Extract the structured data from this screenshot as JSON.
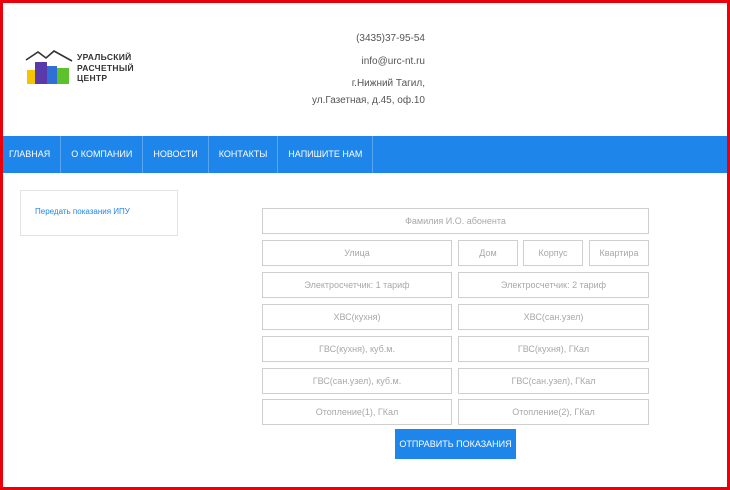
{
  "logo": {
    "lines": [
      "УРАЛЬСКИЙ",
      "РАСЧЕТНЫЙ",
      "ЦЕНТР"
    ]
  },
  "contacts": {
    "phone": "(3435)37-95-54",
    "email": "info@urc-nt.ru",
    "city": "г.Нижний Тагил,",
    "address": "ул.Газетная, д.45, оф.10"
  },
  "nav": {
    "items": [
      "ГЛАВНАЯ",
      "О КОМПАНИИ",
      "НОВОСТИ",
      "КОНТАКТЫ",
      "НАПИШИТЕ НАМ"
    ]
  },
  "sidebar": {
    "link": "Передать показания ИПУ"
  },
  "form": {
    "fio": "Фамилия И.О. абонента",
    "street": "Улица",
    "house": "Дом",
    "korpus": "Корпус",
    "flat": "Квартира",
    "elec1": "Электросчетчик: 1 тариф",
    "elec2": "Электросчетчик: 2 тариф",
    "hvs_kitchen": "ХВС(кухня)",
    "hvs_bath": "ХВС(сан.узел)",
    "gvs_kitchen_m3": "ГВС(кухня), куб.м.",
    "gvs_kitchen_gcal": "ГВС(кухня), ГКал",
    "gvs_bath_m3": "ГВС(сан.узел), куб.м.",
    "gvs_bath_gcal": "ГВС(сан.узел), ГКал",
    "heat1": "Отопление(1), ГКал",
    "heat2": "Отопление(2), ГКал",
    "submit": "ОТПРАВИТЬ ПОКАЗАНИЯ"
  },
  "colors": {
    "frame": "#e8000b",
    "nav": "#1e86ea",
    "logo_purple": "#5a3aa8",
    "logo_green": "#5cc12a",
    "logo_yellow": "#f5c400",
    "logo_blue": "#2f6fd6"
  }
}
